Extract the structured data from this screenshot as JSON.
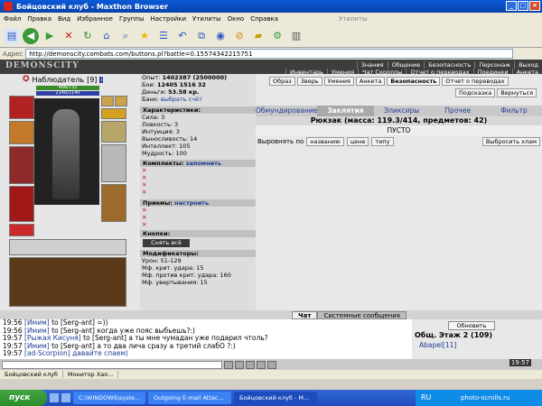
{
  "window": {
    "title": "Бойцовский клуб - Maxthon Browser"
  },
  "menubar": {
    "items": [
      "Файл",
      "Правка",
      "Вид",
      "Избранное",
      "Группы",
      "Настройки",
      "Утилиты",
      "Окно",
      "Справка"
    ],
    "utilities_label": "Утилиты"
  },
  "addressbar": {
    "label": "Адрес",
    "url": "http://demonscity.combats.com/buttons.pl?battle=0.15574342215751"
  },
  "game": {
    "logo": "DEMONSCITY",
    "nav_row1": [
      "Знания",
      "Общение",
      "Безопасность",
      "Персонаж",
      "Выход"
    ],
    "nav_row2": [
      "Инвентарь",
      "Умения",
      "Чат Скроллы",
      "Отчет о переводах",
      "Поединки",
      "Анкета"
    ],
    "character": {
      "name": "Наблюдатель",
      "level": "[9]",
      "hp": "466/732",
      "mana": "2140/2140"
    },
    "stats": {
      "experience_label": "Опыт:",
      "experience": "1402387 (2500000)",
      "battles_label": "Бои:",
      "battles": "12405",
      "wins": "1516",
      "draws": "32",
      "money_label": "Деньги:",
      "money": "53.58 кр.",
      "bank_label": "Банк:",
      "bank_link": "выбрать счёт",
      "characteristics_header": "Характеристики:",
      "strength": "Сила: 3",
      "agility": "Ловкость: 3",
      "intuition": "Интуиция: 3",
      "endurance": "Выносливость: 14",
      "intellect": "Интеллект: 105",
      "wisdom": "Мудрость: 100",
      "sets_header": "Комплекты:",
      "sets_link": "запомнить",
      "techniques_header": "Приемы:",
      "techniques_link": "настроить",
      "buttons_header": "Кнопки:",
      "remove_all": "Снять всё",
      "modifiers_header": "Модификаторы:",
      "damage": "Урон: 51-129",
      "crit": "Мф. крит. удара: 15",
      "anti_crit": "Мф. против крит. удара: 160",
      "dodge": "Мф. увертывания: 15"
    },
    "buttons": [
      "Образ",
      "Зверь",
      "Умения",
      "Анкета",
      "Безопасность",
      "Отчет о переводах"
    ],
    "sub_buttons": [
      "Подсказка",
      "Вернуться"
    ],
    "tabs": [
      "Обмундирование",
      "Заклятия",
      "Эликсиры",
      "Прочее",
      "Фильтр"
    ],
    "active_tab": "Заклятия",
    "backpack": "Рюкзак (масса: 119.3/414, предметов: 42)",
    "empty_label": "ПУСТО",
    "sort_label": "Выровнять по",
    "sort_options": [
      "названию",
      "цене",
      "типу"
    ],
    "throw_trash": "Выбросить хлам"
  },
  "chat": {
    "tabs": [
      "Чат",
      "Системные сообщения"
    ],
    "messages": [
      {
        "time": "19:56",
        "nick": "[Имим]",
        "to": "to [Serg-ant]",
        "text": "=))"
      },
      {
        "time": "19:56",
        "nick": "[Имим]",
        "to": "to [Serg-ant]",
        "text": "когда уже пояс выбьешь?:)"
      },
      {
        "time": "19:57",
        "nick": "[Рыжая Кисуня]",
        "to": "to [Serg-ant]",
        "text": "а ты мне чумадан уже подарил чтоль?"
      },
      {
        "time": "19:57",
        "nick": "[Имим]",
        "to": "to [Serg-ant]",
        "text": "а то два лича сразу а третий слабО ?:)"
      },
      {
        "time": "19:57",
        "nick": "[ad-Scorpion]",
        "to": "",
        "text": "давайте спаем)"
      }
    ],
    "refresh": "Обновить",
    "room": "Общ. Этаж 2 (109)",
    "player": "Abapel[11]",
    "clock": "19:57"
  },
  "statusbar": {
    "tabs": [
      "Бойцовский клуб",
      "Монитор Хао..."
    ]
  },
  "taskbar": {
    "start": "пуск",
    "tasks": [
      "C:\\WINDOWS\\syste...",
      "Outgoing E-mail Attac...",
      "Бойцовский клуб - M..."
    ],
    "lang": "RU",
    "watermark": "photo-scrolls.ru"
  }
}
